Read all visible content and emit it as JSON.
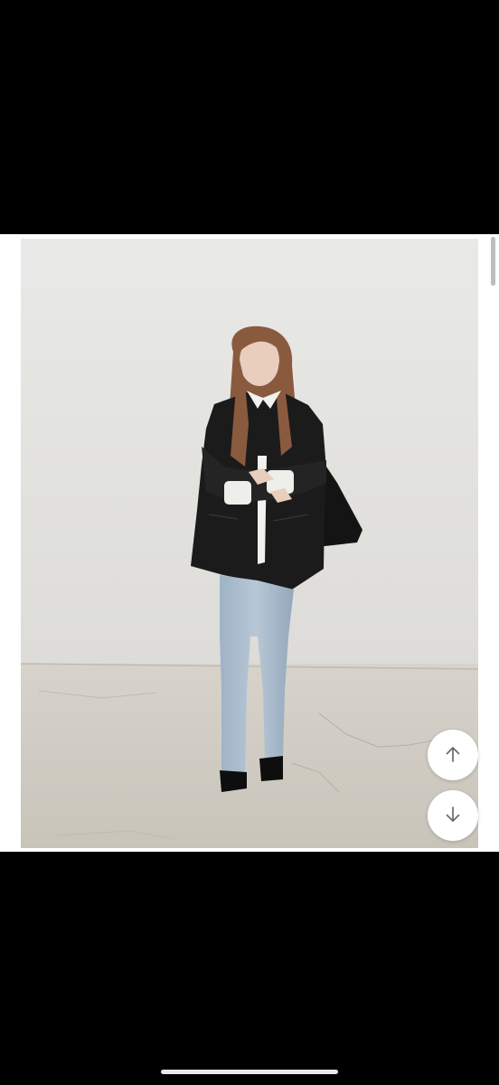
{
  "content": {
    "photo": {
      "subject": "product-photo-model-leather-jacket",
      "colors": {
        "wall": "#e6e6e4",
        "floor": "#cfcbc2",
        "jacket": "#1b1b1c",
        "jeans": "#a9bccd",
        "hair": "#8a5a3f",
        "skin": "#e9cdbd"
      }
    },
    "scroll_up_button": {
      "icon": "arrow-up-icon"
    },
    "scroll_down_button": {
      "icon": "arrow-down-icon"
    },
    "scrollbar": {
      "position": 0.0,
      "visible_fraction": 0.08
    }
  },
  "system": {
    "home_indicator": true
  }
}
